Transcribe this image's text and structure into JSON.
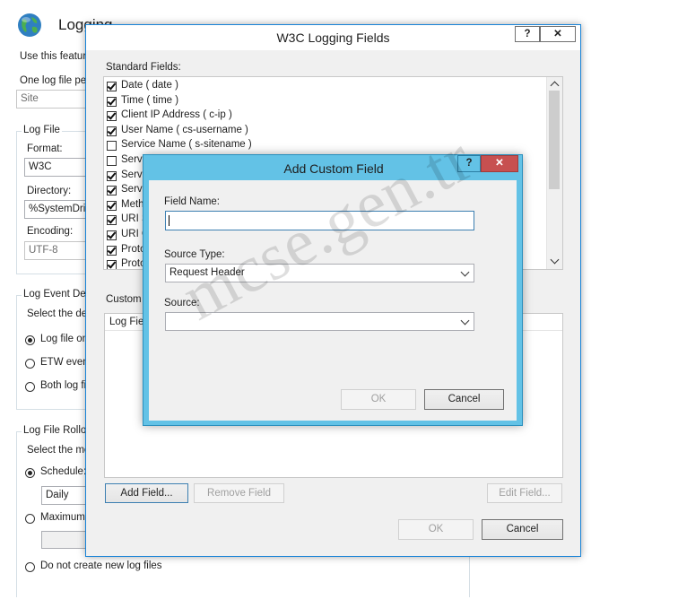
{
  "logging_page": {
    "title": "Logging",
    "intro": "Use this feature",
    "one_log_file_per_label": "One log file per",
    "one_log_file_per_value": "Site",
    "log_file_group": "Log File",
    "format_label": "Format:",
    "format_value": "W3C",
    "directory_label": "Directory:",
    "directory_value": "%SystemDriv",
    "encoding_label": "Encoding:",
    "encoding_value": "UTF-8",
    "event_group": "Log Event Des",
    "event_select": "Select the des",
    "event_opt1": "Log file on",
    "event_opt2": "ETW event",
    "event_opt3": "Both log fi",
    "rollover_group": "Log File Rollo",
    "rollover_select": "Select the me",
    "schedule_label": "Schedule:",
    "schedule_value": "Daily",
    "maximum_label": "Maximum",
    "no_new_files_label": "Do not create new log files"
  },
  "w3c_dialog": {
    "title": "W3C Logging Fields",
    "help_label": "?",
    "close_label": "✕",
    "standard_fields_label": "Standard Fields:",
    "standard_fields": [
      {
        "label": "Date ( date )",
        "checked": true
      },
      {
        "label": "Time ( time )",
        "checked": true
      },
      {
        "label": "Client IP Address ( c-ip )",
        "checked": true
      },
      {
        "label": "User Name ( cs-username )",
        "checked": true
      },
      {
        "label": "Service Name ( s-sitename )",
        "checked": false
      },
      {
        "label": "Serve",
        "checked": false
      },
      {
        "label": "Serve",
        "checked": true
      },
      {
        "label": "Serve",
        "checked": true
      },
      {
        "label": "Meth",
        "checked": true
      },
      {
        "label": "URI S",
        "checked": true
      },
      {
        "label": "URI Q",
        "checked": true
      },
      {
        "label": "Proto",
        "checked": true
      },
      {
        "label": "Proto",
        "checked": true
      }
    ],
    "custom_fields_label": "Custom",
    "custom_col_header": "Log Field",
    "add_field_label": "Add Field...",
    "remove_field_label": "Remove Field",
    "edit_field_label": "Edit Field...",
    "ok_label": "OK",
    "cancel_label": "Cancel"
  },
  "custom_dialog": {
    "title": "Add Custom Field",
    "help_label": "?",
    "close_label": "✕",
    "field_name_label": "Field Name:",
    "field_name_value": "",
    "source_type_label": "Source Type:",
    "source_type_value": "Request Header",
    "source_label": "Source:",
    "source_value": "",
    "ok_label": "OK",
    "cancel_label": "Cancel"
  },
  "watermark": "mcse.gen.tr",
  "colors": {
    "dialog_border": "#1883d7",
    "custom_title_bg": "#63c2e6",
    "close_red": "#c75050",
    "dialog_bg": "#f0f0f0"
  }
}
